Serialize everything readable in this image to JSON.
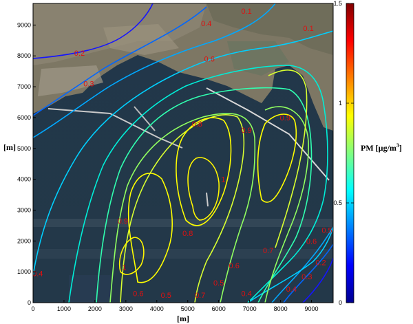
{
  "chart_data": {
    "type": "heatmap",
    "subtype": "contour-over-satellite-image",
    "title": "",
    "xlabel": "[m]",
    "ylabel": "[m]",
    "xlim": [
      0,
      9700
    ],
    "ylim": [
      0,
      9700
    ],
    "x_ticks": [
      "0",
      "1000",
      "2000",
      "3000",
      "4000",
      "5000",
      "6000",
      "7000",
      "8000",
      "9000"
    ],
    "y_ticks": [
      "0",
      "1000",
      "2000",
      "3000",
      "4000",
      "5000",
      "6000",
      "7000",
      "8000",
      "9000"
    ],
    "grid": false,
    "colorbar": {
      "label": "PM  [µg/m³]",
      "label_main": "PM  [µg/m",
      "label_sup": "3",
      "label_end": "]",
      "range": [
        0,
        1.5
      ],
      "ticks": [
        "0",
        "0.5",
        "1",
        "1.5"
      ],
      "colormap": "jet"
    },
    "contour_levels": [
      0.1,
      0.2,
      0.3,
      0.4,
      0.5,
      0.6,
      0.7,
      0.8,
      0.9,
      1.0
    ],
    "contour_labels": [
      {
        "text": "0.1",
        "x": 6900,
        "y": 9450
      },
      {
        "text": "0.1",
        "x": 8900,
        "y": 8900
      },
      {
        "text": "0.2",
        "x": 1500,
        "y": 8100
      },
      {
        "text": "0.4",
        "x": 5600,
        "y": 9050
      },
      {
        "text": "0.6",
        "x": 5700,
        "y": 7900
      },
      {
        "text": "0.3",
        "x": 1800,
        "y": 7100
      },
      {
        "text": "0.8",
        "x": 5300,
        "y": 5800
      },
      {
        "text": "0.9",
        "x": 6900,
        "y": 5600
      },
      {
        "text": "0.9",
        "x": 8150,
        "y": 6000
      },
      {
        "text": "1",
        "x": 6150,
        "y": 4000
      },
      {
        "text": "0.9",
        "x": 2900,
        "y": 2650
      },
      {
        "text": "0.8",
        "x": 5000,
        "y": 2250
      },
      {
        "text": "1",
        "x": 2950,
        "y": 1150
      },
      {
        "text": "0.7",
        "x": 7600,
        "y": 1700
      },
      {
        "text": "0.6",
        "x": 6500,
        "y": 1200
      },
      {
        "text": "0.6",
        "x": 9000,
        "y": 2000
      },
      {
        "text": "0.5",
        "x": 9500,
        "y": 2350
      },
      {
        "text": "0.2",
        "x": 9300,
        "y": 1300
      },
      {
        "text": "0.3",
        "x": 8850,
        "y": 850
      },
      {
        "text": "0.4",
        "x": 150,
        "y": 950
      },
      {
        "text": "0.5",
        "x": 6000,
        "y": 650
      },
      {
        "text": "0.4",
        "x": 8350,
        "y": 450
      },
      {
        "text": "0.4",
        "x": 6900,
        "y": 300
      },
      {
        "text": "0.6",
        "x": 3400,
        "y": 300
      },
      {
        "text": "0.5",
        "x": 4300,
        "y": 250
      },
      {
        "text": "0.7",
        "x": 5400,
        "y": 250
      }
    ]
  }
}
